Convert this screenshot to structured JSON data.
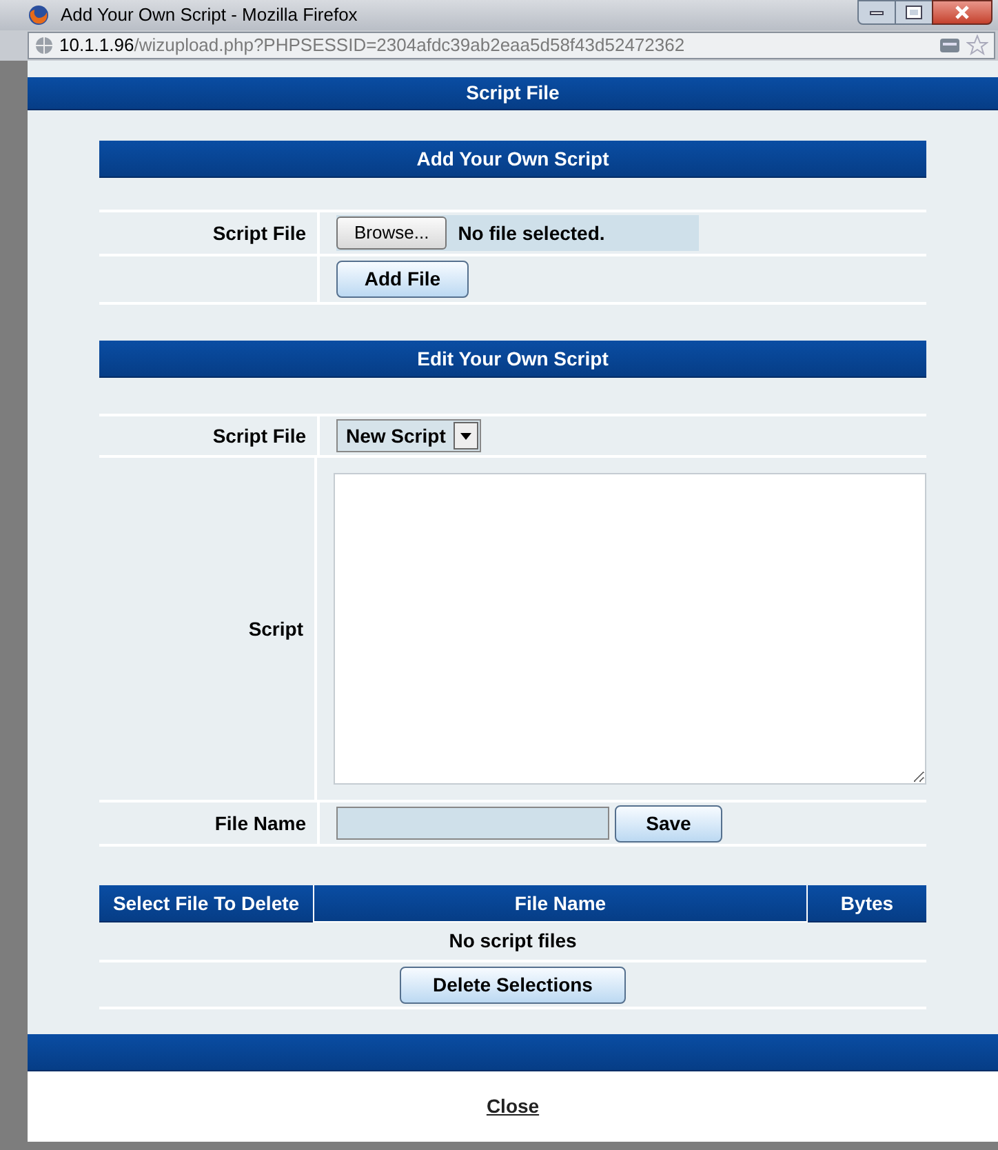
{
  "window": {
    "title": "Add Your Own Script - Mozilla Firefox"
  },
  "address_bar": {
    "host": "10.1.1.96",
    "path": "/wizupload.php?PHPSESSID=2304afdc39ab2eaa5d58f43d52472362"
  },
  "page_header": "Script File",
  "add_section": {
    "title": "Add Your Own Script",
    "label": "Script File",
    "browse_button": "Browse...",
    "file_status": "No file selected.",
    "add_button": "Add File"
  },
  "edit_section": {
    "title": "Edit Your Own Script",
    "script_file_label": "Script File",
    "script_file_value": "New Script",
    "script_label": "Script",
    "file_name_label": "File Name",
    "save_button": "Save"
  },
  "delete_table": {
    "columns": [
      "Select File To Delete",
      "File Name",
      "Bytes"
    ],
    "empty_message": "No script files",
    "delete_button": "Delete Selections"
  },
  "close_link": "Close"
}
